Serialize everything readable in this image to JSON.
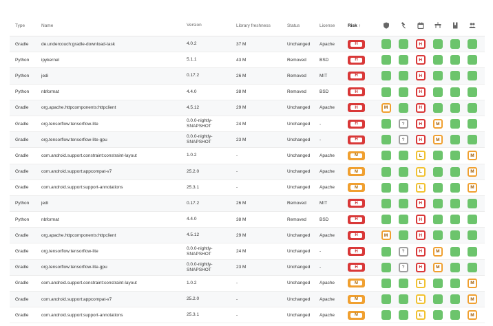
{
  "headers": {
    "type": "Type",
    "name": "Name",
    "version": "Version",
    "freshness": "Library freshness",
    "status": "Status",
    "license": "License",
    "risk": "Risk",
    "risk_sort_icon": "arrow-up-icon",
    "icon_columns": [
      "shield-icon",
      "gavel-icon",
      "calendar-icon",
      "road-work-icon",
      "book-icon",
      "people-icon"
    ]
  },
  "colors": {
    "ok": "#6cc46c",
    "high": "#d93838",
    "medium": "#f0a030",
    "low": "#f2c230",
    "unknown": "#9e9e9e"
  },
  "rows": [
    {
      "type": "Gradle",
      "name": "de.undercouch:gradle-download-task",
      "version": "4.0.2",
      "freshness": "37 M",
      "status": "Unchanged",
      "license": "Apache",
      "risk": "H",
      "cells": [
        "ok",
        "ok",
        "H",
        "ok",
        "ok",
        "ok"
      ]
    },
    {
      "type": "Python",
      "name": "ipykernel",
      "version": "5.1.1",
      "freshness": "43 M",
      "status": "Removed",
      "license": "BSD",
      "risk": "H",
      "cells": [
        "ok",
        "ok",
        "H",
        "ok",
        "ok",
        "ok"
      ]
    },
    {
      "type": "Python",
      "name": "jedi",
      "version": "0.17.2",
      "freshness": "26 M",
      "status": "Removed",
      "license": "MIT",
      "risk": "H",
      "cells": [
        "ok",
        "ok",
        "H",
        "ok",
        "ok",
        "ok"
      ]
    },
    {
      "type": "Python",
      "name": "nbformat",
      "version": "4.4.0",
      "freshness": "38 M",
      "status": "Removed",
      "license": "BSD",
      "risk": "H",
      "cells": [
        "ok",
        "ok",
        "H",
        "ok",
        "ok",
        "ok"
      ]
    },
    {
      "type": "Gradle",
      "name": "org.apache.httpcomponents:httpclient",
      "version": "4.5.12",
      "freshness": "29 M",
      "status": "Unchanged",
      "license": "Apache",
      "risk": "H",
      "cells": [
        "M",
        "ok",
        "H",
        "ok",
        "ok",
        "ok"
      ]
    },
    {
      "type": "Gradle",
      "name": "org.tensorflow:tensorflow-lite",
      "version": "0.0.0-nightly-SNAPSHOT",
      "freshness": "24 M",
      "status": "Unchanged",
      "license": "-",
      "risk": "H",
      "cells": [
        "ok",
        "?",
        "H",
        "M",
        "ok",
        "ok"
      ]
    },
    {
      "type": "Gradle",
      "name": "org.tensorflow:tensorflow-lite-gpu",
      "version": "0.0.0-nightly-SNAPSHOT",
      "freshness": "23 M",
      "status": "Unchanged",
      "license": "-",
      "risk": "H",
      "cells": [
        "ok",
        "?",
        "H",
        "M",
        "ok",
        "ok"
      ]
    },
    {
      "type": "Gradle",
      "name": "com.android.support.constraint:constraint-layout",
      "version": "1.0.2",
      "freshness": "-",
      "status": "Unchanged",
      "license": "Apache",
      "risk": "M",
      "cells": [
        "ok",
        "ok",
        "L",
        "ok",
        "ok",
        "M"
      ]
    },
    {
      "type": "Gradle",
      "name": "com.android.support:appcompat-v7",
      "version": "25.2.0",
      "freshness": "-",
      "status": "Unchanged",
      "license": "Apache",
      "risk": "M",
      "cells": [
        "ok",
        "ok",
        "L",
        "ok",
        "ok",
        "M"
      ]
    },
    {
      "type": "Gradle",
      "name": "com.android.support:support-annotations",
      "version": "25.3.1",
      "freshness": "-",
      "status": "Unchanged",
      "license": "Apache",
      "risk": "M",
      "cells": [
        "ok",
        "ok",
        "L",
        "ok",
        "ok",
        "M"
      ]
    },
    {
      "type": "Python",
      "name": "jedi",
      "version": "0.17.2",
      "freshness": "26 M",
      "status": "Removed",
      "license": "MIT",
      "risk": "H",
      "cells": [
        "ok",
        "ok",
        "H",
        "ok",
        "ok",
        "ok"
      ]
    },
    {
      "type": "Python",
      "name": "nbformat",
      "version": "4.4.0",
      "freshness": "38 M",
      "status": "Removed",
      "license": "BSD",
      "risk": "H",
      "cells": [
        "ok",
        "ok",
        "H",
        "ok",
        "ok",
        "ok"
      ]
    },
    {
      "type": "Gradle",
      "name": "org.apache.httpcomponents:httpclient",
      "version": "4.5.12",
      "freshness": "29 M",
      "status": "Unchanged",
      "license": "Apache",
      "risk": "H",
      "cells": [
        "M",
        "ok",
        "H",
        "ok",
        "ok",
        "ok"
      ]
    },
    {
      "type": "Gradle",
      "name": "org.tensorflow:tensorflow-lite",
      "version": "0.0.0-nightly-SNAPSHOT",
      "freshness": "24 M",
      "status": "Unchanged",
      "license": "-",
      "risk": "H",
      "cells": [
        "ok",
        "?",
        "H",
        "M",
        "ok",
        "ok"
      ]
    },
    {
      "type": "Gradle",
      "name": "org.tensorflow:tensorflow-lite-gpu",
      "version": "0.0.0-nightly-SNAPSHOT",
      "freshness": "23 M",
      "status": "Unchanged",
      "license": "-",
      "risk": "H",
      "cells": [
        "ok",
        "?",
        "H",
        "M",
        "ok",
        "ok"
      ]
    },
    {
      "type": "Gradle",
      "name": "com.android.support.constraint:constraint-layout",
      "version": "1.0.2",
      "freshness": "-",
      "status": "Unchanged",
      "license": "Apache",
      "risk": "M",
      "cells": [
        "ok",
        "ok",
        "L",
        "ok",
        "ok",
        "M"
      ]
    },
    {
      "type": "Gradle",
      "name": "com.android.support:appcompat-v7",
      "version": "25.2.0",
      "freshness": "-",
      "status": "Unchanged",
      "license": "Apache",
      "risk": "M",
      "cells": [
        "ok",
        "ok",
        "L",
        "ok",
        "ok",
        "M"
      ]
    },
    {
      "type": "Gradle",
      "name": "com.android.support:support-annotations",
      "version": "25.3.1",
      "freshness": "-",
      "status": "Unchanged",
      "license": "Apache",
      "risk": "M",
      "cells": [
        "ok",
        "ok",
        "L",
        "ok",
        "ok",
        "M"
      ]
    }
  ]
}
